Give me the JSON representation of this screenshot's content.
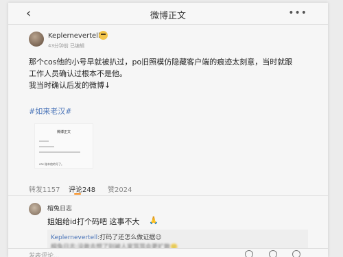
{
  "nav": {
    "back_icon": "‹",
    "title": "微博正文",
    "more_icon": "•••"
  },
  "post": {
    "username": "Keplernevertell",
    "time": "43分钟前",
    "edited": "已编辑",
    "lines": [
      "那个cos他的小号早就被扒过，po旧照模仿隐藏客户端的痕迹太刻意，当时就跟",
      "工作人员确认过根本不是他。",
      "我当时确认后发的微博↓"
    ],
    "hashtag": "#如来老汉#",
    "embedded": {
      "title": "微博正文",
      "caption": "cos 账本他的号了。"
    }
  },
  "tabs": [
    {
      "label": "转发1157",
      "active": false
    },
    {
      "label": "评论248",
      "active": true
    },
    {
      "label": "赞2024",
      "active": false
    }
  ],
  "comment": {
    "user": "榕兔日志",
    "text": "姐姐给id打个码吧 这事不大",
    "reply_user": "Keplernevertell",
    "reply_text": ":打码了还怎么做证据😉",
    "reply_partial": "榕兔日志:没敢去想了别被人家骂骂会更扩散🙂"
  },
  "bottom": {
    "placeholder": "发表评论..."
  },
  "colors": {
    "link": "#4a74b8",
    "tab_accent": "#f78c1a"
  }
}
